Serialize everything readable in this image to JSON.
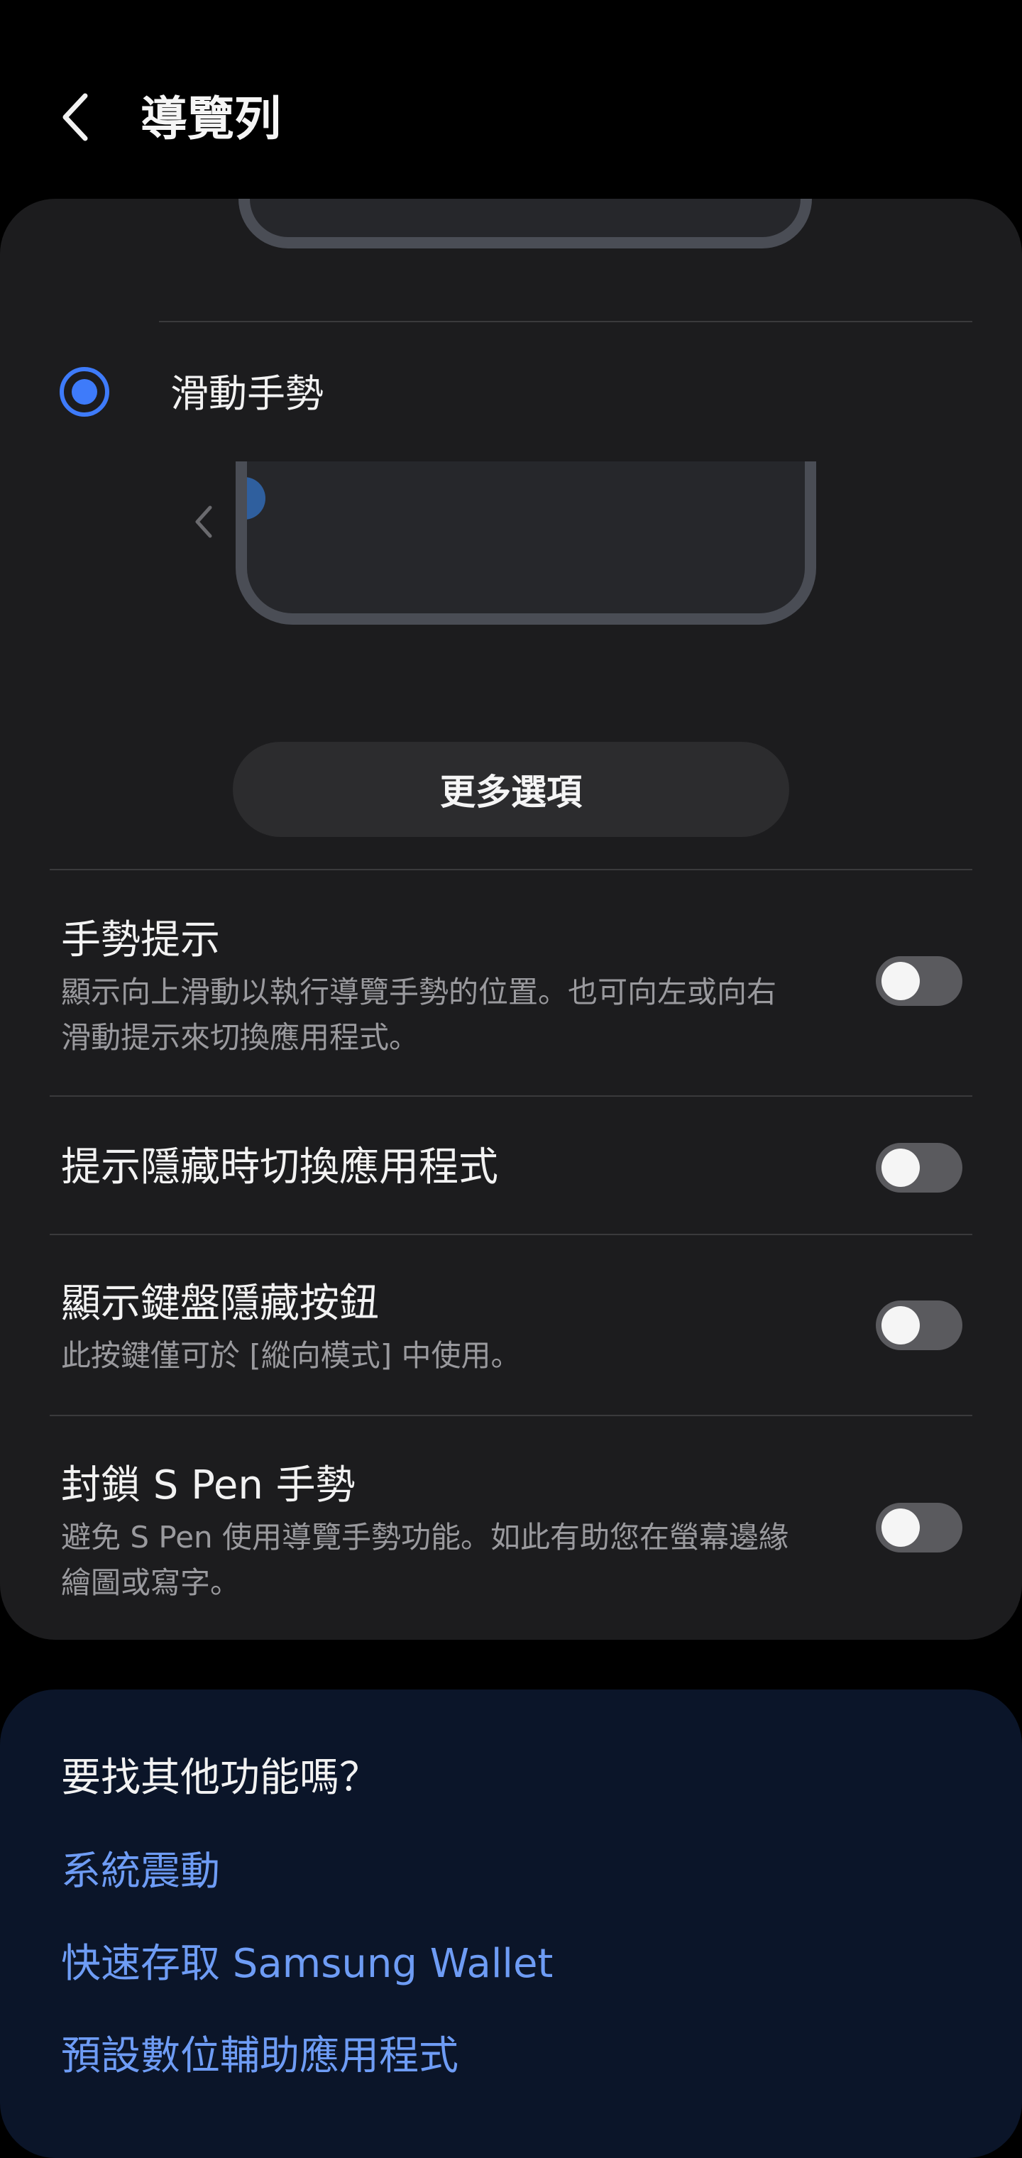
{
  "header": {
    "title": "導覽列"
  },
  "navigation_option": {
    "label": "滑動手勢",
    "selected": true,
    "more_options_label": "更多選項"
  },
  "settings": [
    {
      "title": "手勢提示",
      "description_line1": "顯示向上滑動以執行導覽手勢的位置。也可向左或向右",
      "description_line2": "滑動提示來切換應用程式。",
      "enabled": false
    },
    {
      "title": "提示隱藏時切換應用程式",
      "enabled": false
    },
    {
      "title": "顯示鍵盤隱藏按鈕",
      "description_line1": "此按鍵僅可於 [縱向模式] 中使用。",
      "enabled": false
    },
    {
      "title": "封鎖 S Pen 手勢",
      "description_line1": "避免 S Pen 使用導覽手勢功能。如此有助您在螢幕邊緣",
      "description_line2": "繪圖或寫字。",
      "enabled": false
    }
  ],
  "suggestions": {
    "title": "要找其他功能嗎？",
    "links": [
      "系統震動",
      "快速存取 Samsung Wallet",
      "預設數位輔助應用程式"
    ]
  },
  "colors": {
    "accent": "#3e7bfa",
    "link": "#6e9cf5",
    "card": "#1c1c1e",
    "suggestion_card": "#0b1529"
  }
}
